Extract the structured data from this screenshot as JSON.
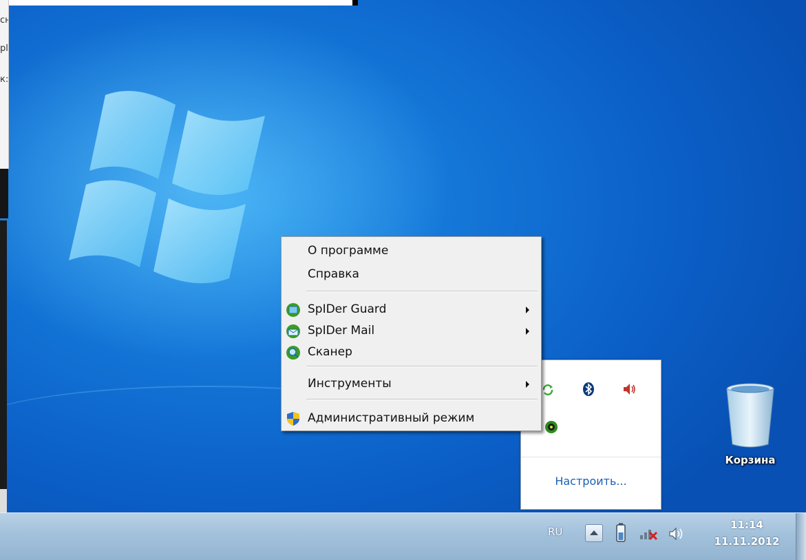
{
  "background_window": {
    "lines": [
      "сн",
      "рl",
      "к:"
    ]
  },
  "context_menu": {
    "items": [
      {
        "label": "О программе",
        "icon": "",
        "has_submenu": false
      },
      {
        "label": "Справка",
        "icon": "",
        "has_submenu": false
      },
      {
        "label": "SpIDer Guard",
        "icon": "spider-guard-icon",
        "has_submenu": true
      },
      {
        "label": "SpIDer Mail",
        "icon": "spider-mail-icon",
        "has_submenu": true
      },
      {
        "label": "Сканер",
        "icon": "scanner-icon",
        "has_submenu": false
      },
      {
        "label": "Инструменты",
        "icon": "",
        "has_submenu": true
      },
      {
        "label": "Административный режим",
        "icon": "uac-shield-icon",
        "has_submenu": false
      }
    ]
  },
  "tray_overflow": {
    "icons": [
      "sync-icon",
      "bluetooth-icon",
      "speaker-icon",
      "drweb-spider-icon"
    ],
    "customize_label": "Настроить..."
  },
  "desktop": {
    "recycle_bin_label": "Корзина"
  },
  "taskbar": {
    "language": "RU",
    "time": "11:14",
    "date": "11.11.2012",
    "tray_icons": [
      "show-hidden-icons-button",
      "battery-icon",
      "network-disconnected-icon",
      "volume-icon"
    ]
  },
  "colors": {
    "accent_link": "#1a5fb4",
    "desktop_blue": "#0b5fc7",
    "menu_bg": "#f0f0f0"
  }
}
